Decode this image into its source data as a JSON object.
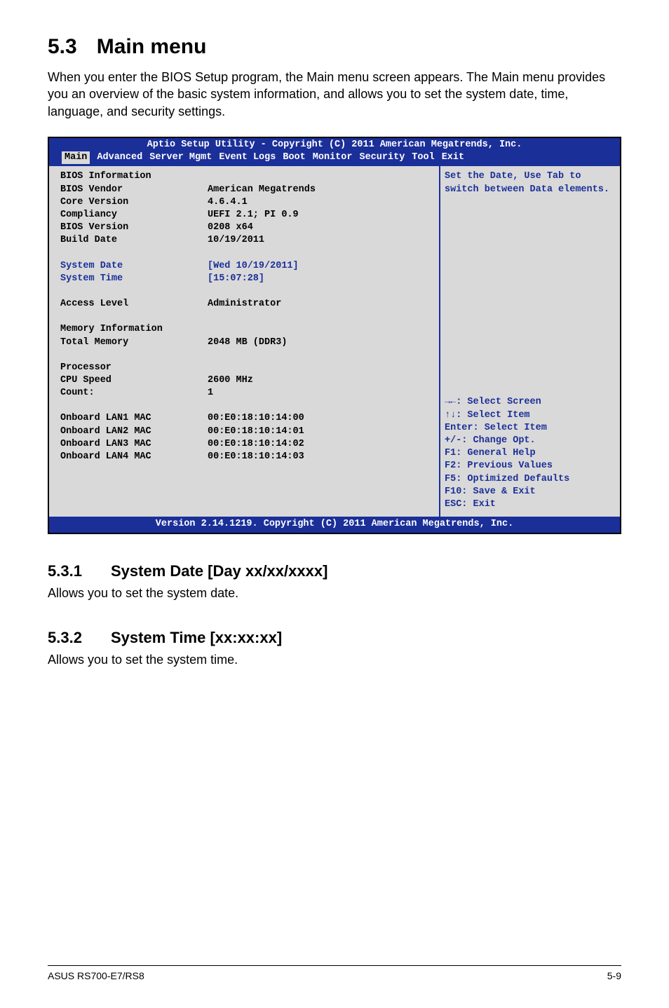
{
  "section": {
    "number": "5.3",
    "title": "Main menu"
  },
  "intro": "When you enter the BIOS Setup program, the Main menu screen appears. The Main menu provides you an overview of the basic system information, and allows you to set the system date, time, language, and security settings.",
  "bios": {
    "header_top": "Aptio Setup Utility - Copyright (C) 2011 American Megatrends, Inc.",
    "tabs": [
      "Main",
      "Advanced",
      "Server Mgmt",
      "Event Logs",
      "Boot",
      "Monitor",
      "Security",
      "Tool",
      "Exit"
    ],
    "active_tab": "Main",
    "groups": {
      "bios_info_title": "BIOS Information",
      "bios_vendor": {
        "label": "BIOS Vendor",
        "value": "American Megatrends"
      },
      "core_version": {
        "label": "Core Version",
        "value": "4.6.4.1"
      },
      "compliancy": {
        "label": "Compliancy",
        "value": "UEFI 2.1; PI 0.9"
      },
      "bios_version": {
        "label": "BIOS Version",
        "value": "0208 x64"
      },
      "build_date": {
        "label": "Build Date",
        "value": "10/19/2011"
      },
      "system_date": {
        "label": "System Date",
        "value": "[Wed 10/19/2011]"
      },
      "system_time": {
        "label": "System Time",
        "value": "[15:07:28]"
      },
      "access_level": {
        "label": "Access Level",
        "value": "Administrator"
      },
      "mem_info_title": "Memory Information",
      "total_memory": {
        "label": "Total Memory",
        "value": "2048 MB (DDR3)"
      },
      "processor_title": "Processor",
      "cpu_speed": {
        "label": "CPU Speed",
        "value": "2600 MHz"
      },
      "count": {
        "label": "Count:",
        "value": "1"
      },
      "lan1": {
        "label": "Onboard LAN1 MAC",
        "value": "00:E0:18:10:14:00"
      },
      "lan2": {
        "label": "Onboard LAN2 MAC",
        "value": "00:E0:18:10:14:01"
      },
      "lan3": {
        "label": "Onboard LAN3 MAC",
        "value": "00:E0:18:10:14:02"
      },
      "lan4": {
        "label": "Onboard LAN4 MAC",
        "value": "00:E0:18:10:14:03"
      }
    },
    "help_top": [
      "Set the Date, Use Tab to",
      "switch between Data elements."
    ],
    "help_bottom": [
      "→←: Select Screen",
      "↑↓:  Select Item",
      "Enter: Select Item",
      "+/-: Change Opt.",
      "F1: General Help",
      "F2: Previous Values",
      "F5: Optimized Defaults",
      "F10: Save & Exit",
      "ESC: Exit"
    ],
    "footer": "Version 2.14.1219. Copyright (C) 2011 American Megatrends, Inc."
  },
  "sub1": {
    "number": "5.3.1",
    "title": "System Date [Day xx/xx/xxxx]",
    "text": "Allows you to set the system date."
  },
  "sub2": {
    "number": "5.3.2",
    "title": "System Time [xx:xx:xx]",
    "text": "Allows you to set the system time."
  },
  "footer": {
    "left": "ASUS RS700-E7/RS8",
    "right": "5-9"
  }
}
